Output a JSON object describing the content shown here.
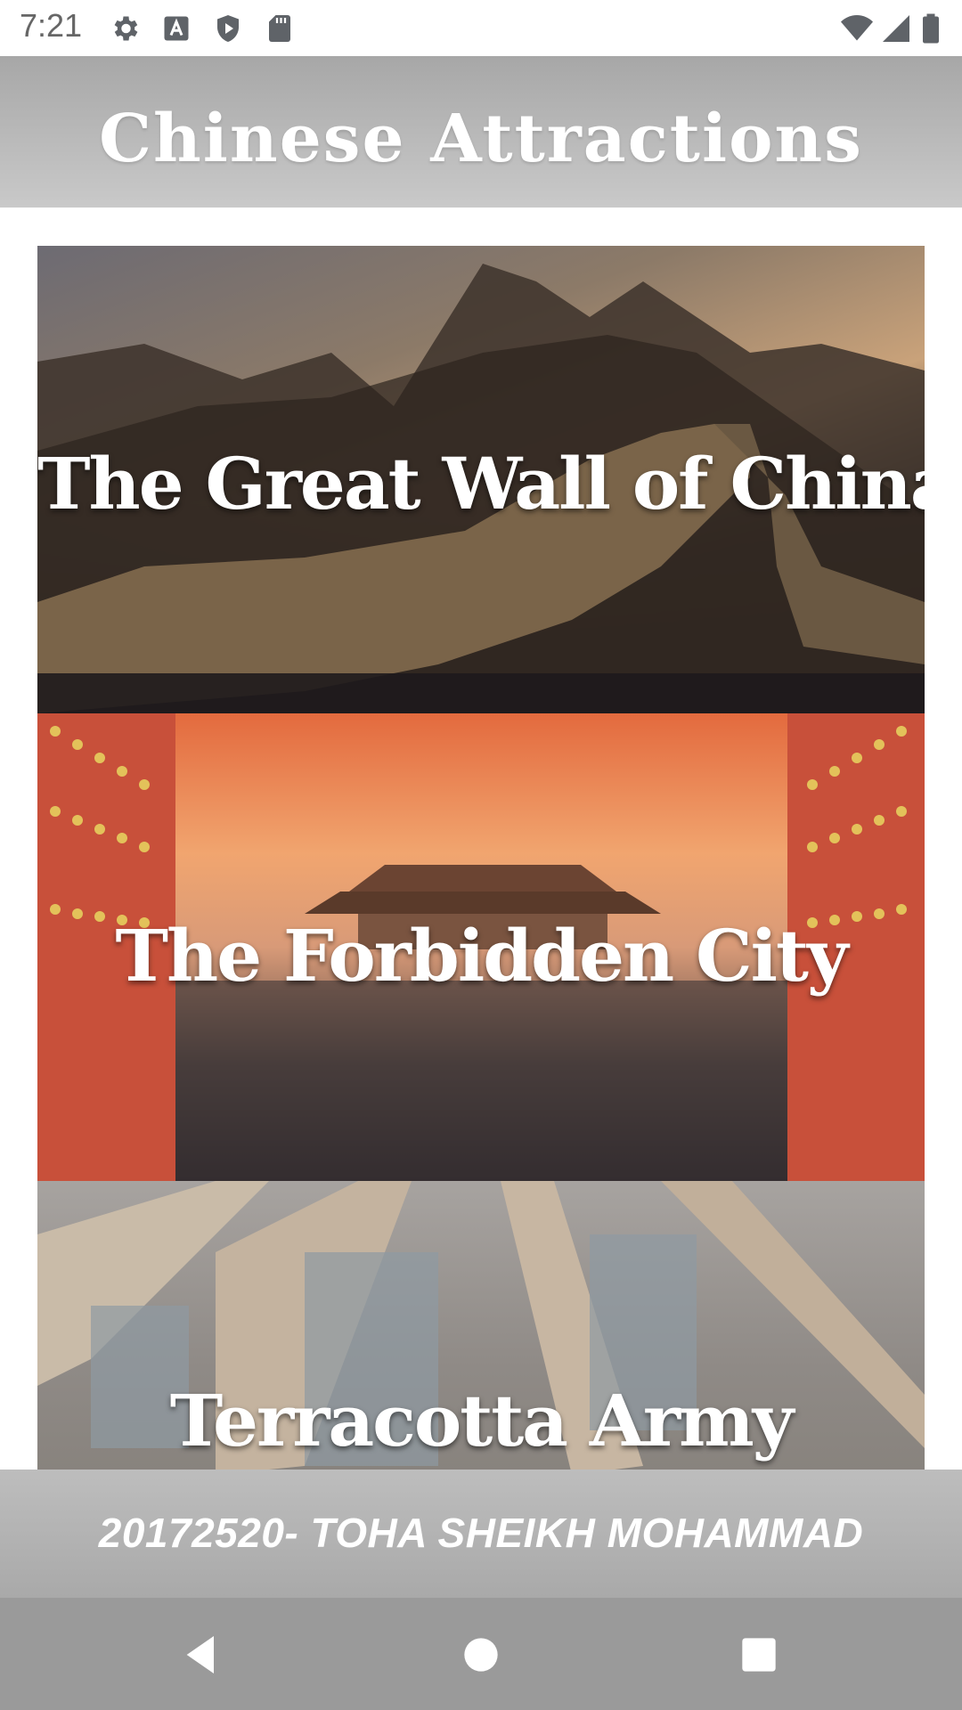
{
  "status_bar": {
    "time": "7:21",
    "icons": [
      "gear-icon",
      "a-icon",
      "shield-play-icon",
      "sd-card-icon",
      "wifi-icon",
      "signal-icon",
      "battery-icon"
    ]
  },
  "app_bar": {
    "title": "Chinese Attractions"
  },
  "attractions": [
    {
      "label": "The Great Wall of China"
    },
    {
      "label": "The Forbidden City"
    },
    {
      "label": "Terracotta Army"
    }
  ],
  "footer": {
    "text": "20172520- TOHA SHEIKH MOHAMMAD"
  },
  "nav_bar": {
    "icons": [
      "back-icon",
      "home-icon",
      "recents-icon"
    ]
  },
  "colors": {
    "app_bar": "#b3b3b3",
    "footer": "#b3b3b3",
    "nav_bar": "#9a9a9a"
  }
}
